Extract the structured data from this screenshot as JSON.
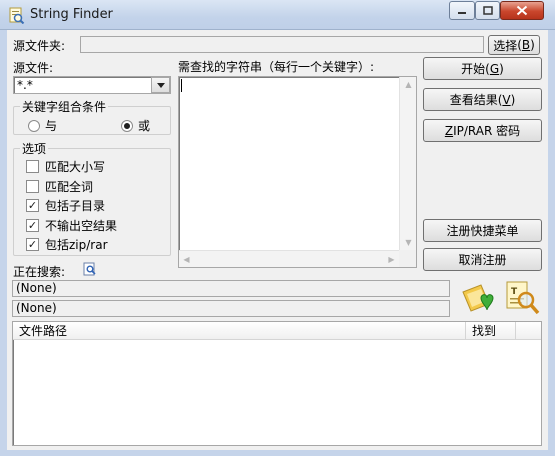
{
  "window": {
    "title": "String Finder",
    "controls": {
      "minimize": "minimize-icon",
      "maximize": "maximize-icon",
      "close": "close-icon"
    }
  },
  "source_folder": {
    "label": "源文件夹:",
    "value": "",
    "browse_label": "选择",
    "browse_hotkey": "B"
  },
  "source_files": {
    "label": "源文件:",
    "value": "*.*"
  },
  "keyword_area": {
    "label": "需查找的字符串（每行一个关键字）:",
    "value": ""
  },
  "combine_condition": {
    "title": "关键字组合条件",
    "options": [
      {
        "label": "与",
        "selected": false
      },
      {
        "label": "或",
        "selected": true
      }
    ]
  },
  "options_group": {
    "title": "选项",
    "items": [
      {
        "label": "匹配大小写",
        "checked": false
      },
      {
        "label": "匹配全词",
        "checked": false
      },
      {
        "label": "包括子目录",
        "checked": true
      },
      {
        "label": "不输出空结果",
        "checked": true
      },
      {
        "label": "包括zip/rar",
        "checked": true
      }
    ]
  },
  "buttons": {
    "start": {
      "label": "开始",
      "hotkey": "G"
    },
    "view_results": {
      "label": "查看结果",
      "hotkey": "V"
    },
    "zip_password": {
      "hotkey": "Z",
      "label": "IP/RAR 密码"
    },
    "register_menu": {
      "label": "注册快捷菜单"
    },
    "unregister": {
      "label": "取消注册"
    }
  },
  "searching": {
    "label": "正在搜索:",
    "status1": "(None)",
    "status2": "(None)"
  },
  "results_table": {
    "columns": [
      "文件路径",
      "找到"
    ],
    "rows": []
  },
  "colors": {
    "titlebar": "#c3d3ea",
    "window_bg": "#f0f0f0",
    "close_button": "#c9462c"
  }
}
